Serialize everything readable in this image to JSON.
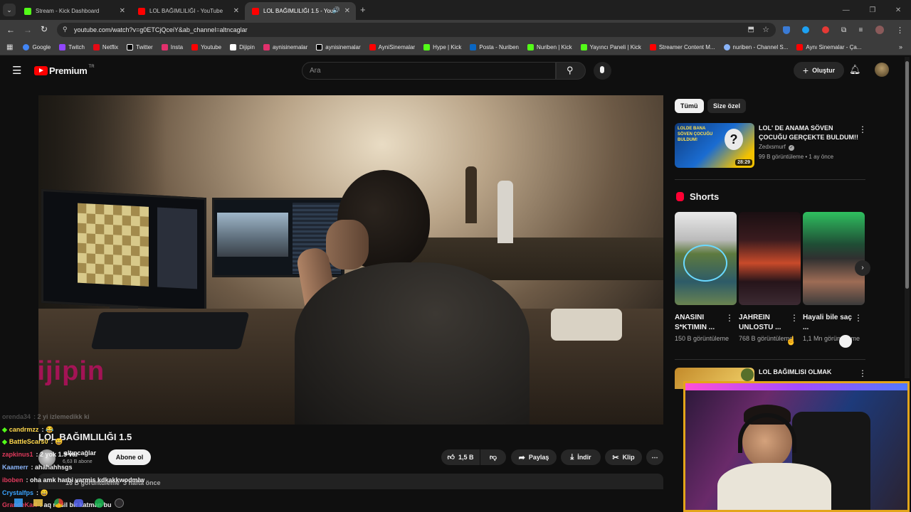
{
  "tabs": [
    {
      "title": "Stream - Kick Dashboard",
      "favicon_color": "#53fc18"
    },
    {
      "title": "LOL BAĞIMLILIĞI - YouTube",
      "favicon_color": "#ff0000"
    },
    {
      "title": "LOL BAĞIMLILIĞI 1.5 - YouT",
      "favicon_color": "#ff0000"
    }
  ],
  "new_tab": "+",
  "address": "youtube.com/watch?v=g0ETCjQceiY&ab_channel=altncaglar",
  "bookmarks": [
    {
      "label": "Google",
      "color": "#4285f4"
    },
    {
      "label": "Twitch",
      "color": "#9146ff"
    },
    {
      "label": "Netflix",
      "color": "#e50914"
    },
    {
      "label": "Twitter",
      "color": "#ffffff"
    },
    {
      "label": "Insta",
      "color": "#e1306c"
    },
    {
      "label": "Youtube",
      "color": "#ff0000"
    },
    {
      "label": "Dijipin",
      "color": "#ffffff"
    },
    {
      "label": "aynisinemalar",
      "color": "#e1306c"
    },
    {
      "label": "aynisinemalar",
      "color": "#ffffff"
    },
    {
      "label": "AyniSinemalar",
      "color": "#ff0000"
    },
    {
      "label": "Hype | Kick",
      "color": "#53fc18"
    },
    {
      "label": "Posta - Nuriben",
      "color": "#0a66c2"
    },
    {
      "label": "Nuriben | Kick",
      "color": "#53fc18"
    },
    {
      "label": "Yayıncı Paneli | Kick",
      "color": "#53fc18"
    },
    {
      "label": "Streamer Content M...",
      "color": "#ff0000"
    },
    {
      "label": "nuriben - Channel S...",
      "color": "#8ab4f8"
    },
    {
      "label": "Aynı Sinemalar - Ça...",
      "color": "#ff0000"
    }
  ],
  "youtube": {
    "logo": "Premium",
    "logo_badge": "TR",
    "search_placeholder": "Ara",
    "create_label": "Oluştur"
  },
  "video": {
    "title": "LOL BAĞIMLILIĞI 1.5",
    "watermark": "Dijipin",
    "channel_name": "altıncağlar",
    "subscribers": "6,63 B abone",
    "subscribe_label": "Abone ol",
    "likes": "1,5 B",
    "share_label": "Paylaş",
    "download_label": "İndir",
    "clip_label": "Klip",
    "meta": "16 B görüntüleme  3 hafta önce"
  },
  "chips": {
    "all": "Tümü",
    "for_you": "Size özel"
  },
  "recommended": [
    {
      "title": "LOL' DE ANAMA SÖVEN ÇOCUĞU GERÇEKTE BULDUM!!",
      "channel": "Zedxsmurf",
      "meta": "99 B görüntüleme • 1 ay önce",
      "duration": "28:29",
      "thumb_text": "LOLDE BANA SÖVEN ÇOCUĞU BULDUM!"
    },
    {
      "title": "LOL BAĞIMLISI OLMAK"
    }
  ],
  "shorts_label": "Shorts",
  "shorts": [
    {
      "title": "ANASINI S*KTIMIN ...",
      "views": "150 B görüntüleme"
    },
    {
      "title": "JAHREIN UNLOSTU ...",
      "views": "768 B görüntüleme"
    },
    {
      "title": "Hayali bile saç ...",
      "views": "1,1 Mn görüntüleme"
    }
  ],
  "chat": [
    {
      "user": "orenda34",
      "text": "2 yi izlemedikk ki",
      "user_color": "#7a7a7a",
      "faded": true
    },
    {
      "user": "candrmzz",
      "text": "😂",
      "user_color": "#ffd84d"
    },
    {
      "user": "BattleScars0",
      "text": "😄",
      "user_color": "#ffd84d"
    },
    {
      "user": "zapkinus1",
      "text": "2 yok 1.5 var",
      "user_color": "#e03a5c"
    },
    {
      "user": "Kaamerr",
      "text": "ahahahhsgs",
      "user_color": "#8ab4f8"
    },
    {
      "user": "iboben",
      "text": "oha amk harbi varmis kdkakkwodmlw",
      "user_color": "#e03a5c"
    },
    {
      "user": "Crystalfps",
      "text": "😄",
      "user_color": "#3aa3ff"
    },
    {
      "user": "GrandeKarl",
      "text": "aq nasil bir katman bu",
      "user_color": "#e03a5c"
    }
  ]
}
